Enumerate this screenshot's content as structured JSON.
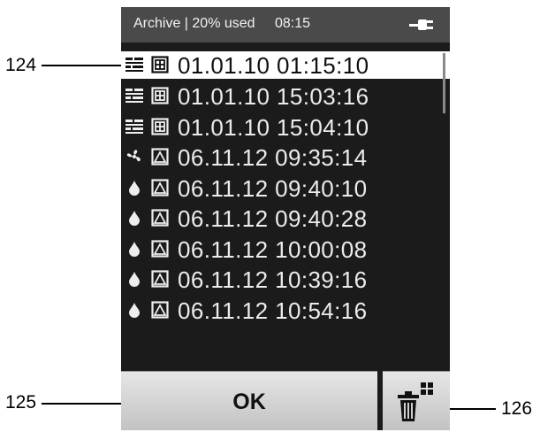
{
  "callouts": {
    "list_ref": "124",
    "ok_ref": "125",
    "delete_ref": "126"
  },
  "status_bar": {
    "label": "Archive | 20% used",
    "time": "08:15",
    "power_icon": "plug-icon"
  },
  "archive_rows": [
    {
      "stamp": "01.01.10 01:15:10",
      "type_icon": "grid-list-icon",
      "mode_icon": "boxed-plus-icon",
      "selected": true
    },
    {
      "stamp": "01.01.10 15:03:16",
      "type_icon": "grid-list-icon",
      "mode_icon": "boxed-plus-icon",
      "selected": false
    },
    {
      "stamp": "01.01.10 15:04:10",
      "type_icon": "grid-list-icon",
      "mode_icon": "boxed-plus-icon",
      "selected": false
    },
    {
      "stamp": "06.11.12 09:35:14",
      "type_icon": "fan-icon",
      "mode_icon": "boxed-triangle-icon",
      "selected": false
    },
    {
      "stamp": "06.11.12 09:40:10",
      "type_icon": "droplet-icon",
      "mode_icon": "boxed-triangle-icon",
      "selected": false
    },
    {
      "stamp": "06.11.12 09:40:28",
      "type_icon": "droplet-icon",
      "mode_icon": "boxed-triangle-icon",
      "selected": false
    },
    {
      "stamp": "06.11.12 10:00:08",
      "type_icon": "droplet-icon",
      "mode_icon": "boxed-triangle-icon",
      "selected": false
    },
    {
      "stamp": "06.11.12 10:39:16",
      "type_icon": "droplet-icon",
      "mode_icon": "boxed-triangle-icon",
      "selected": false
    },
    {
      "stamp": "06.11.12 10:54:16",
      "type_icon": "droplet-icon",
      "mode_icon": "boxed-triangle-icon",
      "selected": false
    }
  ],
  "buttons": {
    "ok_label": "OK",
    "delete_icon": "trash-with-grid-icon"
  },
  "colors": {
    "screen_bg": "#1b1b1b",
    "status_bg": "#4a4a4a",
    "selected_bg": "#ffffff",
    "button_bg": "#d4d4d4"
  }
}
